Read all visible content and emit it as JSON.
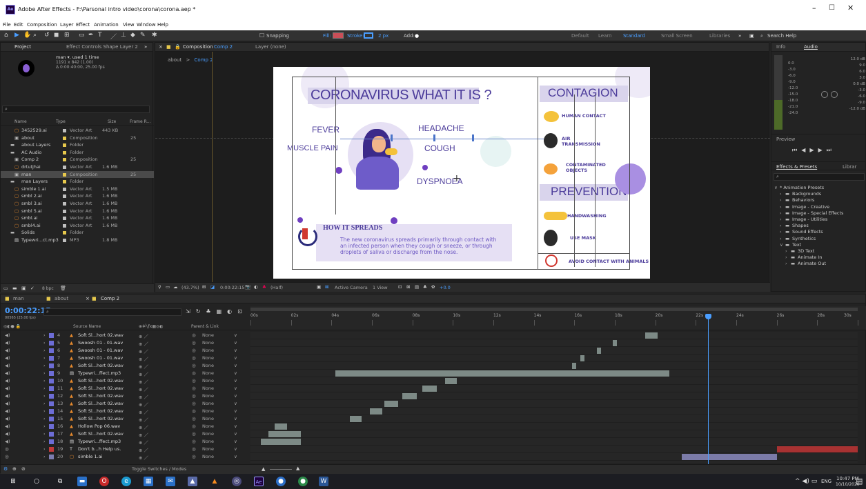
{
  "window": {
    "title": "Adobe After Effects - F:\\Parsonal intro video\\corona\\corona.aep *",
    "app_badge": "Ae"
  },
  "menu": [
    "File",
    "Edit",
    "Composition",
    "Layer",
    "Effect",
    "Animation",
    "View",
    "Window",
    "Help"
  ],
  "toolbar": {
    "snapping": "Snapping",
    "fill": "Fill:",
    "stroke": "Stroke:",
    "stroke_width": "2 px",
    "add": "Add:"
  },
  "workspaces": [
    "Default",
    "Learn",
    "Standard",
    "Small Screen",
    "Libraries"
  ],
  "search_help": "Search Help",
  "project": {
    "tab": "Project",
    "effect_tab": "Effect Controls Shape Layer 2",
    "item_name": "man ▾, used 1 time",
    "item_dims": "1191 x 842 (1.00)",
    "item_duration": "Δ 0:00:40:00, 25.00 fps",
    "columns": [
      "Name",
      "Type",
      "Size",
      "Frame R..."
    ],
    "items": [
      {
        "name": "3452529.ai",
        "type": "Vector Art",
        "size": "443 KB",
        "rate": "",
        "icon": "ai",
        "color": "#bfbfbf"
      },
      {
        "name": "about",
        "type": "Composition",
        "size": "",
        "rate": "25",
        "icon": "comp",
        "color": "#e6c84c"
      },
      {
        "name": "about Layers",
        "type": "Folder",
        "size": "",
        "rate": "",
        "icon": "folder",
        "color": "#e6c84c"
      },
      {
        "name": "AC Audio",
        "type": "Folder",
        "size": "",
        "rate": "",
        "icon": "folder",
        "color": "#e6c84c"
      },
      {
        "name": "Comp 2",
        "type": "Composition",
        "size": "",
        "rate": "25",
        "icon": "comp",
        "color": "#e6c84c"
      },
      {
        "name": "drtutjhai",
        "type": "Vector Art",
        "size": "1.6 MB",
        "rate": "",
        "icon": "ai",
        "color": "#bfbfbf"
      },
      {
        "name": "man",
        "type": "Composition",
        "size": "",
        "rate": "25",
        "icon": "comp",
        "color": "#e6c84c"
      },
      {
        "name": "man Layers",
        "type": "Folder",
        "size": "",
        "rate": "",
        "icon": "folder",
        "color": "#e6c84c"
      },
      {
        "name": "simble 1.ai",
        "type": "Vector Art",
        "size": "1.5 MB",
        "rate": "",
        "icon": "ai",
        "color": "#bfbfbf"
      },
      {
        "name": "smbl 2.ai",
        "type": "Vector Art",
        "size": "1.6 MB",
        "rate": "",
        "icon": "ai",
        "color": "#bfbfbf"
      },
      {
        "name": "smbl 3.ai",
        "type": "Vector Art",
        "size": "1.6 MB",
        "rate": "",
        "icon": "ai",
        "color": "#bfbfbf"
      },
      {
        "name": "smbl 5.ai",
        "type": "Vector Art",
        "size": "1.6 MB",
        "rate": "",
        "icon": "ai",
        "color": "#bfbfbf"
      },
      {
        "name": "smbl.ai",
        "type": "Vector Art",
        "size": "1.6 MB",
        "rate": "",
        "icon": "ai",
        "color": "#bfbfbf"
      },
      {
        "name": "smbl4.ai",
        "type": "Vector Art",
        "size": "1.6 MB",
        "rate": "",
        "icon": "ai",
        "color": "#bfbfbf"
      },
      {
        "name": "Solids",
        "type": "Folder",
        "size": "",
        "rate": "",
        "icon": "folder",
        "color": "#e6c84c"
      },
      {
        "name": "Typewri...ct.mp3",
        "type": "MP3",
        "size": "1.8 MB",
        "rate": "",
        "icon": "mp3",
        "color": "#bfbfbf"
      }
    ],
    "bpc": "8 bpc"
  },
  "composition": {
    "tab": "Composition",
    "comp_name": "Comp 2",
    "layer_tab": "Layer (none)",
    "breadcrumb": [
      "about",
      "Comp 2"
    ],
    "footer": {
      "zoom": "(43.7%)",
      "timecode": "0:00:22:15",
      "resolution": "(Half)",
      "camera": "Active Camera",
      "views": "1 View",
      "exposure": "+0.0"
    }
  },
  "infographic": {
    "title": "CORONAVIRUS WHAT IT IS ?",
    "contagion": "CONTAGION",
    "prevention": "PREVENTION",
    "symptoms": [
      "FEVER",
      "HEADACHE",
      "MUSCLE PAIN",
      "COUGH",
      "DYSPNOEA"
    ],
    "contagion_items": [
      "HUMAN CONTACT",
      "AIR TRANSMISSION",
      "CONTAMINATED OBJECTS"
    ],
    "prevention_items": [
      "HANDWASHING",
      "USE MASK",
      "AVOID CONTACT WITH ANIMALS"
    ],
    "spread_title": "HOW IT SPREADS",
    "spread_text": "The new coronavirus spreads primarily through contact with an infected person when they cough or sneeze, or through droplets of saliva or discharge from the nose."
  },
  "right_panel": {
    "info_tab": "Info",
    "audio_tab": "Audio",
    "audio_levels_left": [
      "0.0",
      "-3.0",
      "-6.0",
      "-9.0",
      "-12.0",
      "-15.0",
      "-18.0",
      "-21.0",
      "-24.0"
    ],
    "audio_levels_right": [
      "12.0 dB",
      "9.0",
      "6.0",
      "3.0",
      "0.0 dB",
      "-3.0",
      "-6.0",
      "-9.0",
      "-12.0 dB"
    ],
    "preview_tab": "Preview",
    "effects_tab": "Effects & Presets",
    "libraries_tab": "Librar",
    "effects_tree": [
      {
        "label": "* Animation Presets",
        "depth": 0
      },
      {
        "label": "Backgrounds",
        "depth": 1
      },
      {
        "label": "Behaviors",
        "depth": 1
      },
      {
        "label": "Image - Creative",
        "depth": 1
      },
      {
        "label": "Image - Special Effects",
        "depth": 1
      },
      {
        "label": "Image - Utilities",
        "depth": 1
      },
      {
        "label": "Shapes",
        "depth": 1
      },
      {
        "label": "Sound Effects",
        "depth": 1
      },
      {
        "label": "Synthetics",
        "depth": 1
      },
      {
        "label": "Text",
        "depth": 1
      },
      {
        "label": "3D Text",
        "depth": 2
      },
      {
        "label": "Animate In",
        "depth": 2
      },
      {
        "label": "Animate Out",
        "depth": 2
      }
    ]
  },
  "timeline": {
    "tabs": [
      "man",
      "about",
      "Comp 2"
    ],
    "timecode": "0:00:22:15",
    "frame_info": "00565 (25.00 fps)",
    "columns": {
      "source": "Source Name",
      "parent": "Parent & Link"
    },
    "ruler": [
      "00s",
      "02s",
      "04s",
      "06s",
      "08s",
      "10s",
      "12s",
      "14s",
      "16s",
      "18s",
      "20s",
      "22s",
      "24s",
      "26s",
      "28s",
      "30s"
    ],
    "toggle_label": "Toggle Switches / Modes",
    "layers": [
      {
        "num": "4",
        "name": "Soft Sl...hort 02.wav",
        "kind": "audio",
        "label": "#6d6dd6",
        "parent": "None",
        "start": 19.5,
        "end": 20.1
      },
      {
        "num": "5",
        "name": "Swoosh 01 - 01.wav",
        "kind": "audio",
        "label": "#6d6dd6",
        "parent": "None",
        "start": 17.9,
        "end": 18.1
      },
      {
        "num": "6",
        "name": "Swoosh 01 - 01.wav",
        "kind": "audio",
        "label": "#6d6dd6",
        "parent": "None",
        "start": 17.1,
        "end": 17.3
      },
      {
        "num": "7",
        "name": "Swoosh 01 - 01.wav",
        "kind": "audio",
        "label": "#6d6dd6",
        "parent": "None",
        "start": 16.3,
        "end": 16.5
      },
      {
        "num": "8",
        "name": "Soft Sl...hort 02.wav",
        "kind": "audio",
        "label": "#6d6dd6",
        "parent": "None",
        "start": 15.9,
        "end": 16.1
      },
      {
        "num": "9",
        "name": "Typewri...ffect.mp3",
        "kind": "mp3",
        "label": "#6d6dd6",
        "parent": "None",
        "start": 4.2,
        "end": 20.7
      },
      {
        "num": "10",
        "name": "Soft Sl...hort 02.wav",
        "kind": "audio",
        "label": "#6d6dd6",
        "parent": "None",
        "start": 9.6,
        "end": 10.2
      },
      {
        "num": "11",
        "name": "Soft Sl...hort 02.wav",
        "kind": "audio",
        "label": "#6d6dd6",
        "parent": "None",
        "start": 8.5,
        "end": 9.2
      },
      {
        "num": "12",
        "name": "Soft Sl...hort 02.wav",
        "kind": "audio",
        "label": "#6d6dd6",
        "parent": "None",
        "start": 7.5,
        "end": 8.2
      },
      {
        "num": "13",
        "name": "Soft Sl...hort 02.wav",
        "kind": "audio",
        "label": "#6d6dd6",
        "parent": "None",
        "start": 6.6,
        "end": 7.3
      },
      {
        "num": "14",
        "name": "Soft Sl...hort 02.wav",
        "kind": "audio",
        "label": "#6d6dd6",
        "parent": "None",
        "start": 5.9,
        "end": 6.5
      },
      {
        "num": "15",
        "name": "Soft Sl...hort 02.wav",
        "kind": "audio",
        "label": "#6d6dd6",
        "parent": "None",
        "start": 4.9,
        "end": 5.5
      },
      {
        "num": "16",
        "name": "Hollow Pop 06.wav",
        "kind": "audio",
        "label": "#6d6dd6",
        "parent": "None",
        "start": 1.2,
        "end": 1.8
      },
      {
        "num": "17",
        "name": "Soft Sl...hort 02.wav",
        "kind": "audio",
        "label": "#6d6dd6",
        "parent": "None",
        "start": 0.9,
        "end": 2.5
      },
      {
        "num": "18",
        "name": "Typewri...ffect.mp3",
        "kind": "mp3",
        "label": "#6d6dd6",
        "parent": "None",
        "start": 0.5,
        "end": 2.5
      },
      {
        "num": "19",
        "name": "Don't b...h Help us.",
        "kind": "text",
        "label": "#c23a3a",
        "parent": "None",
        "start": 26.0,
        "end": 30.0
      },
      {
        "num": "20",
        "name": "simble 1.ai",
        "kind": "ai",
        "label": "#7d7db0",
        "parent": "None",
        "start": 21.3,
        "end": 26.0
      }
    ]
  },
  "system_tray": {
    "lang": "ENG",
    "time": "10:47 PM",
    "date": "10/10/2020"
  }
}
